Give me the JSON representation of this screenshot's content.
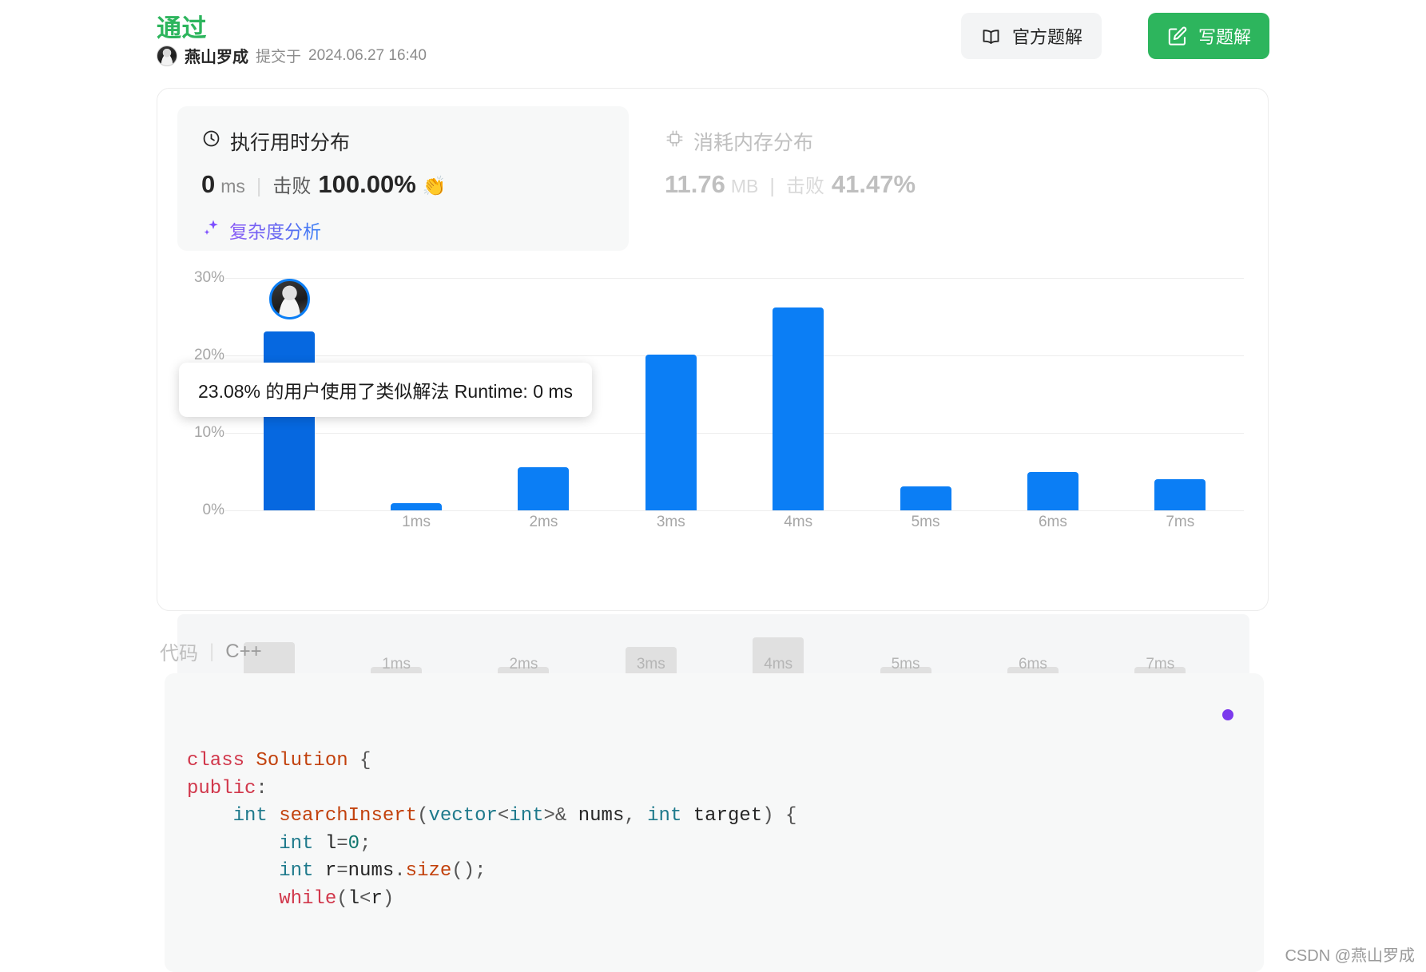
{
  "header": {
    "status": "通过",
    "submitter": "燕山罗成",
    "submitted_prefix": "提交于",
    "submitted_at": "2024.06.27 16:40",
    "official_solution_button": "官方题解",
    "write_solution_button": "写题解",
    "green_accent": "#2db55d"
  },
  "runtime_panel": {
    "title": "执行用时分布",
    "icon": "clock-icon",
    "value": "0",
    "unit": "ms",
    "beat_label": "击败",
    "beat_percent": "100.00%",
    "clap": "👏",
    "complexity_link": "复杂度分析",
    "complexity_icon": "sparkle-icon"
  },
  "memory_panel": {
    "title": "消耗内存分布",
    "icon": "chip-icon",
    "value": "11.76",
    "unit": "MB",
    "beat_label": "击败",
    "beat_percent": "41.47%"
  },
  "tooltip": {
    "text": "23.08% 的用户使用了类似解法 Runtime: 0 ms"
  },
  "chart_data": {
    "type": "bar",
    "title": "执行用时分布",
    "xlabel": "",
    "ylabel": "",
    "categories": [
      "0ms",
      "1ms",
      "2ms",
      "3ms",
      "4ms",
      "5ms",
      "6ms",
      "7ms"
    ],
    "x_tick_labels": [
      "1ms",
      "2ms",
      "3ms",
      "4ms",
      "5ms",
      "6ms",
      "7ms"
    ],
    "values": [
      23.08,
      0.9,
      5.6,
      20.1,
      26.2,
      3.1,
      5.0,
      4.0
    ],
    "y_tick_labels": [
      "30%",
      "20%",
      "10%",
      "0%"
    ],
    "y_ticks": [
      30,
      20,
      10,
      0
    ],
    "ylim": [
      0,
      32
    ],
    "grid": true,
    "legend": "none",
    "bar_color": "#0b7ef5",
    "highlight_color": "#0668e0",
    "highlighted_category": "0ms",
    "highlight_marker": "user-avatar"
  },
  "brush": {
    "labels": [
      "1ms",
      "2ms",
      "3ms",
      "4ms",
      "5ms",
      "6ms",
      "7ms"
    ],
    "values": [
      23.08,
      0.9,
      5.6,
      20.1,
      26.2,
      3.1,
      5.0,
      4.0
    ]
  },
  "code_section": {
    "label": "代码",
    "separator": "|",
    "language": "C++",
    "lines": [
      "class Solution {",
      "public:",
      "    int searchInsert(vector<int>& nums, int target) {",
      "        int l=0;",
      "        int r=nums.size();",
      "        while(l<r)"
    ]
  },
  "watermark": "CSDN @燕山罗成"
}
